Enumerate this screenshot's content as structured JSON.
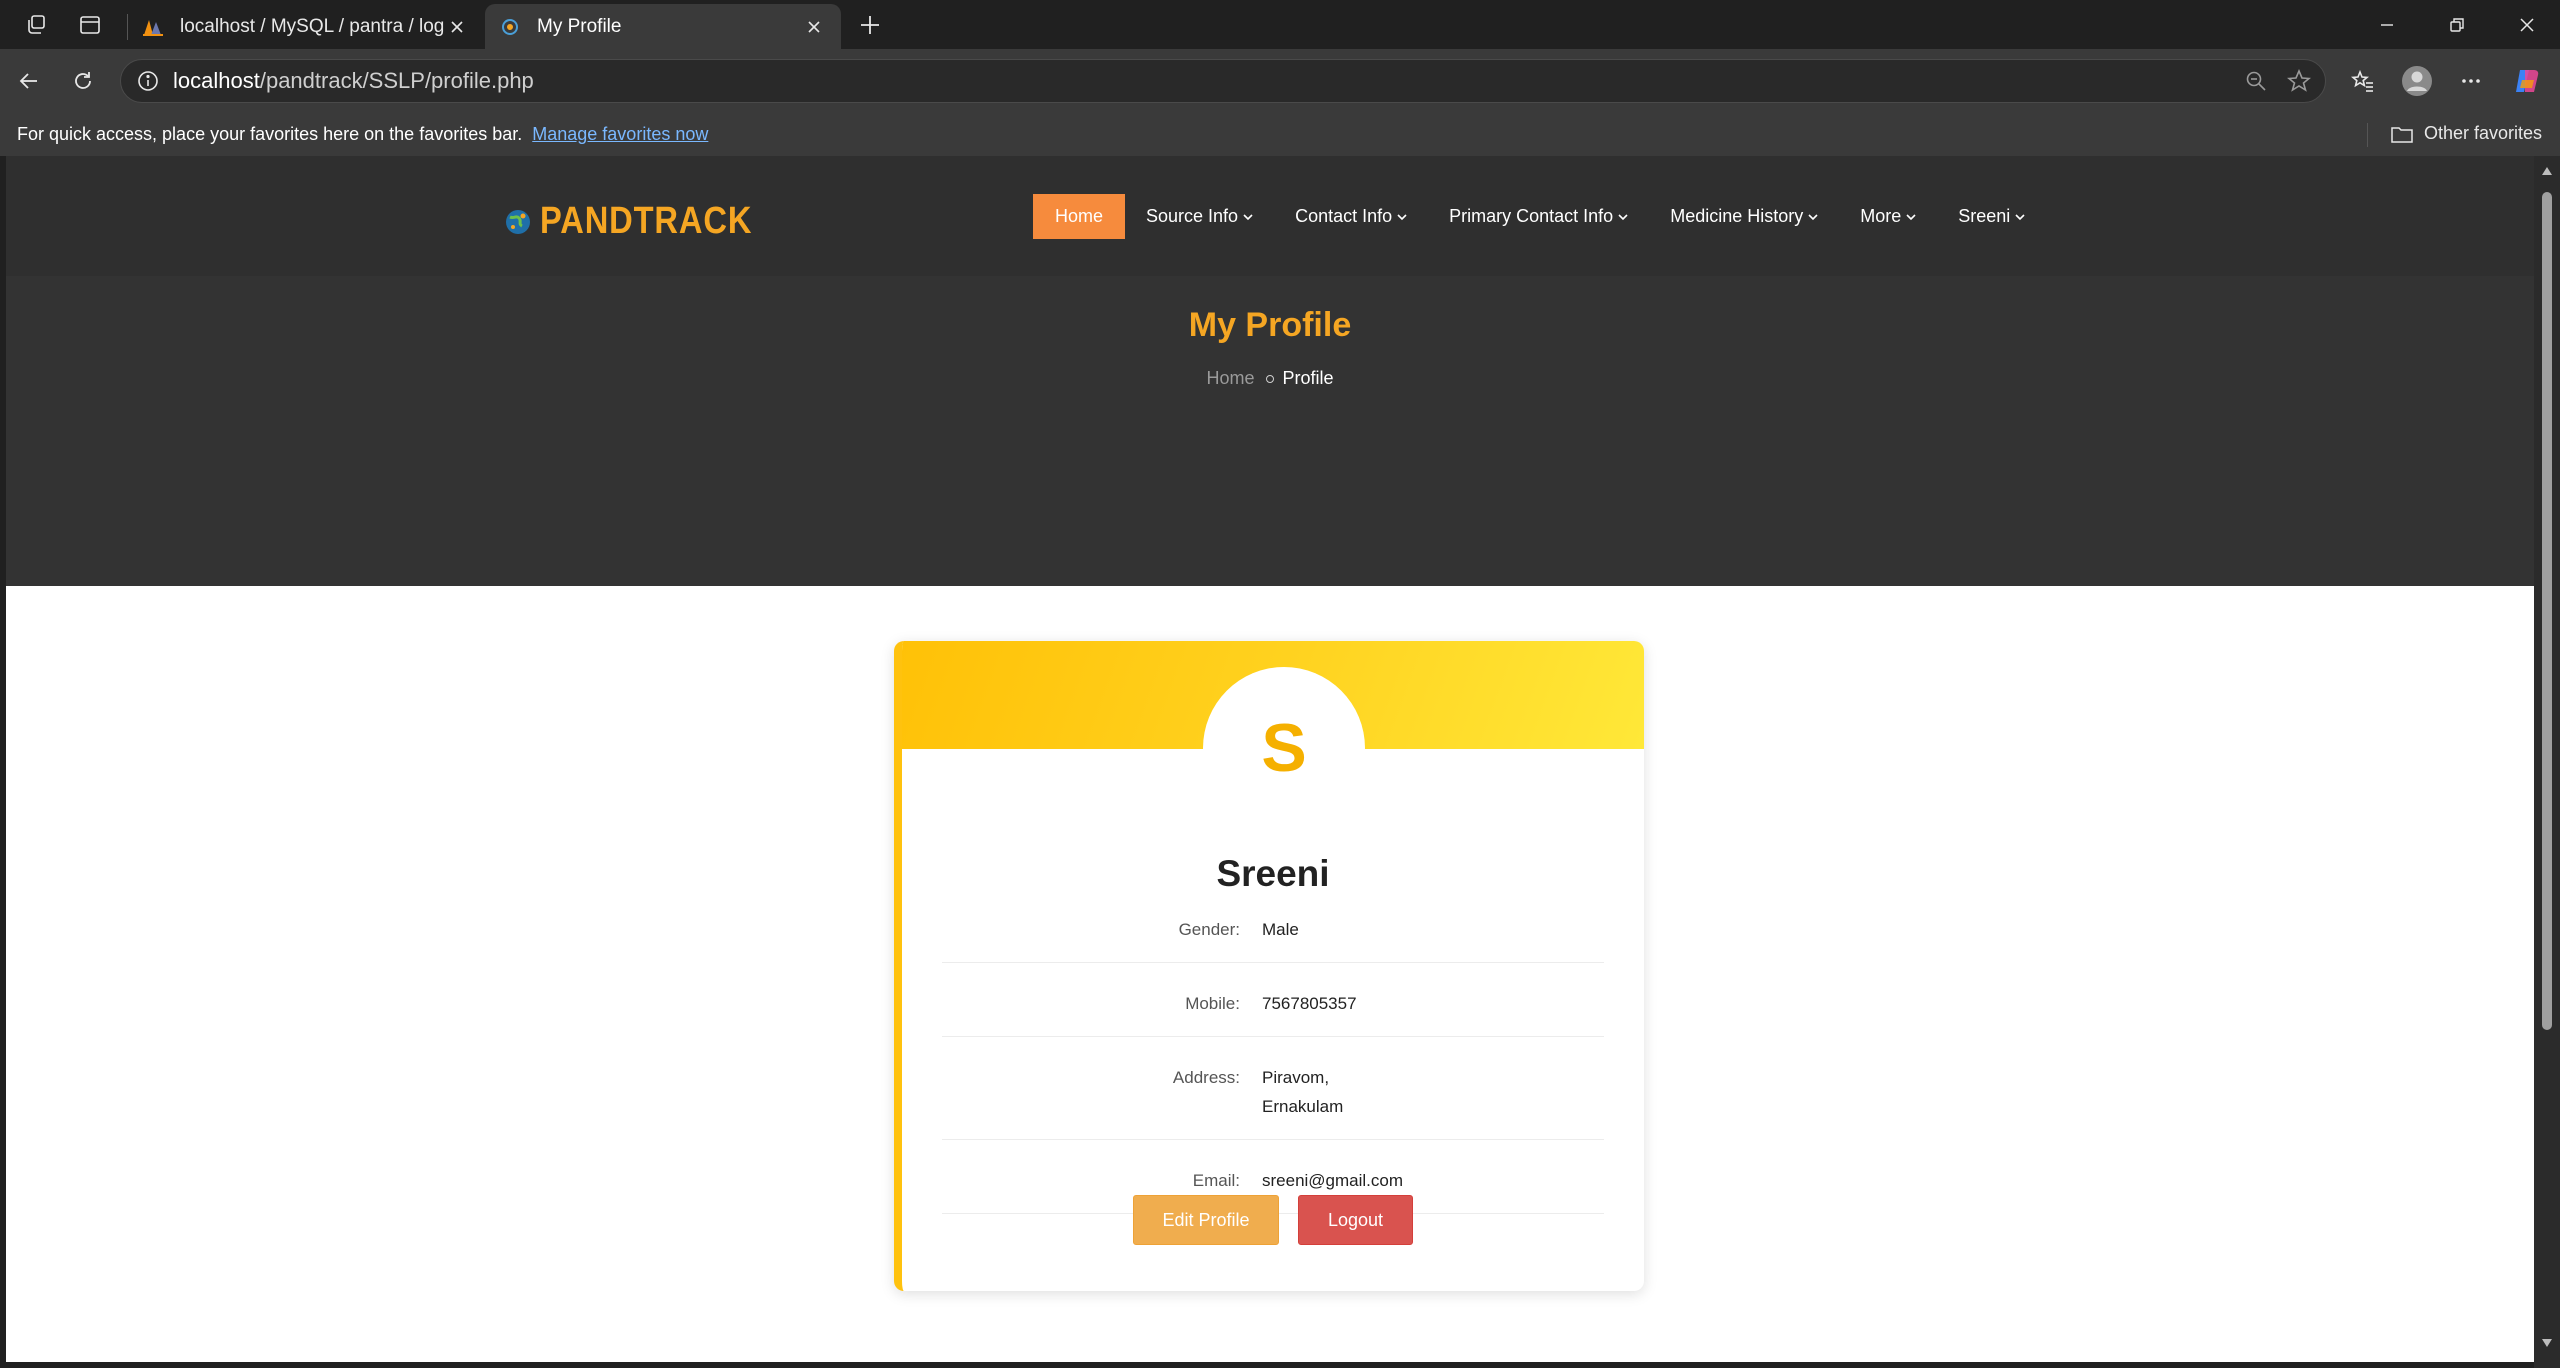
{
  "browser": {
    "tabs": [
      {
        "title": "localhost / MySQL / pantra / login",
        "active": false
      },
      {
        "title": "My Profile",
        "active": true
      }
    ],
    "url_host": "localhost",
    "url_path": "/pandtrack/SSLP/profile.php",
    "favorites_message": "For quick access, place your favorites here on the favorites bar.",
    "favorites_link": "Manage favorites now",
    "other_favorites": "Other favorites"
  },
  "site": {
    "logo_text": "PANDTRACK",
    "nav": [
      {
        "label": "Home",
        "active": true,
        "dropdown": false
      },
      {
        "label": "Source Info",
        "active": false,
        "dropdown": true
      },
      {
        "label": "Contact Info",
        "active": false,
        "dropdown": true
      },
      {
        "label": "Primary Contact Info",
        "active": false,
        "dropdown": true
      },
      {
        "label": "Medicine History",
        "active": false,
        "dropdown": true
      },
      {
        "label": "More",
        "active": false,
        "dropdown": true
      },
      {
        "label": "Sreeni",
        "active": false,
        "dropdown": true
      }
    ]
  },
  "banner": {
    "title": "My Profile",
    "breadcrumb_home": "Home",
    "breadcrumb_current": "Profile"
  },
  "profile": {
    "initial": "S",
    "name": "Sreeni",
    "gender_label": "Gender:",
    "gender": "Male",
    "mobile_label": "Mobile:",
    "mobile": "7567805357",
    "address_label": "Address:",
    "address_line1": "Piravom,",
    "address_line2": "Ernakulam",
    "email_label": "Email:",
    "email": "sreeni@gmail.com",
    "edit_label": "Edit Profile",
    "logout_label": "Logout"
  },
  "colors": {
    "accent_orange": "#f5a623",
    "nav_active": "#f68b3d",
    "card_gold": "#ffc107",
    "edit_button": "#f0ad4e",
    "logout_button": "#d9534f"
  }
}
